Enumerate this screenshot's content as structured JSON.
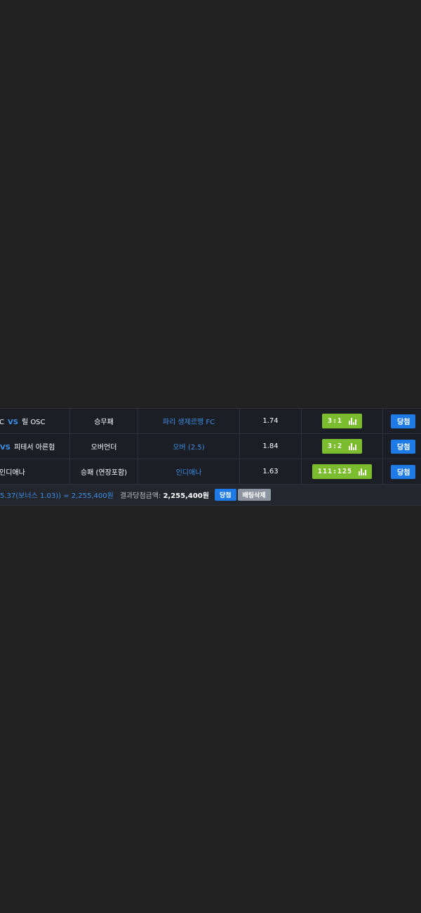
{
  "bets": [
    {
      "home": "C",
      "vs": "VS",
      "away": "릴 OSC",
      "bet_type": "승무패",
      "pick": "파리 생제르맹 FC",
      "odds": "1.74",
      "score": "3:1",
      "result": "당첨"
    },
    {
      "home": "",
      "vs": "VS",
      "away": "피테서 아른험",
      "bet_type": "오버언더",
      "pick": "오버 (2.5)",
      "odds": "1.84",
      "score": "3:2",
      "result": "당첨"
    },
    {
      "home": "인디애나",
      "vs": "",
      "away": "",
      "bet_type": "승패 (연장포함)",
      "pick": "인디애나",
      "odds": "1.63",
      "score": "111:125",
      "result": "당첨"
    }
  ],
  "summary": {
    "calc": "5.37(보너스 1.03)) = 2,255,400원",
    "payout_label": "결과당첨금액:",
    "payout_value": "2,255,400원",
    "status_button": "당첨",
    "delete_button": "배팅삭제"
  },
  "colors": {
    "background": "#212121",
    "panel": "#1b1e25",
    "accent_blue": "#1e7ae6",
    "score_green": "#7cbd2f",
    "delete_grey": "#8c95a1"
  },
  "icons": {
    "score_badge": "bar-chart-icon"
  }
}
